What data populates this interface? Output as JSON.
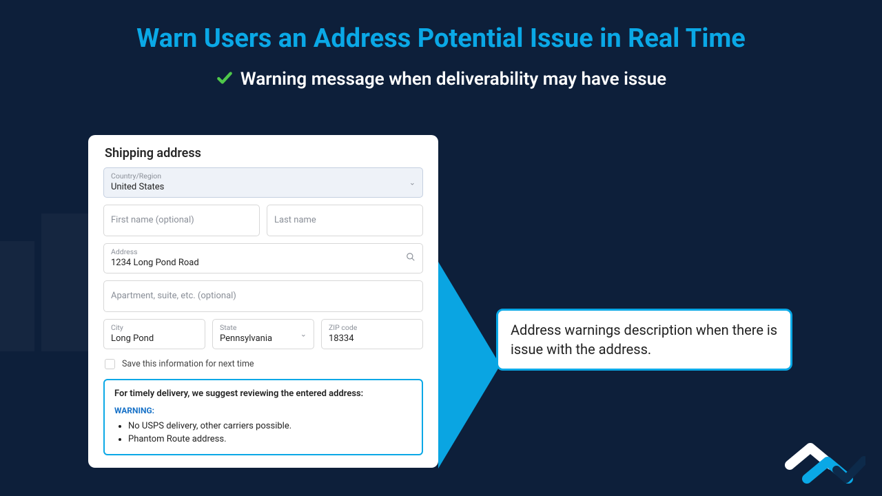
{
  "hero": {
    "title": "Warn Users an Address Potential Issue in Real Time",
    "subtitle": "Warning message when deliverability may have issue"
  },
  "form": {
    "title": "Shipping address",
    "country_label": "Country/Region",
    "country_value": "United States",
    "first_name_placeholder": "First name (optional)",
    "last_name_placeholder": "Last name",
    "address_label": "Address",
    "address_value": "1234 Long Pond Road",
    "apt_placeholder": "Apartment, suite, etc. (optional)",
    "city_label": "City",
    "city_value": "Long Pond",
    "state_label": "State",
    "state_value": "Pennsylvania",
    "zip_label": "ZIP code",
    "zip_value": "18334",
    "save_info": "Save this information for next time"
  },
  "warning": {
    "heading": "For timely delivery, we suggest reviewing the entered address:",
    "label": "WARNING:",
    "items": [
      "No USPS delivery, other carriers possible.",
      "Phantom Route address."
    ]
  },
  "callout": {
    "text": "Address warnings description when there is issue with the address."
  }
}
